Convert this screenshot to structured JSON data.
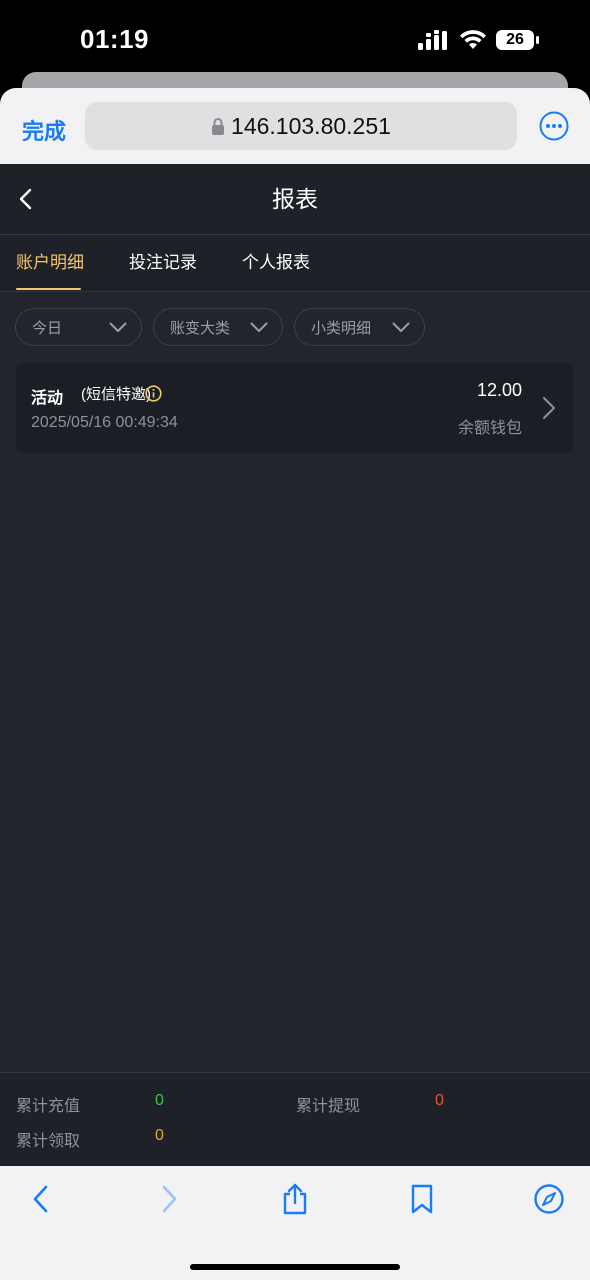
{
  "status_bar": {
    "time": "01:19",
    "battery": "26"
  },
  "browser": {
    "done_label": "完成",
    "url": "146.103.80.251"
  },
  "header": {
    "title": "报表"
  },
  "tabs": [
    {
      "label": "账户明细",
      "active": true
    },
    {
      "label": "投注记录",
      "active": false
    },
    {
      "label": "个人报表",
      "active": false
    }
  ],
  "filters": [
    {
      "label": "今日"
    },
    {
      "label": "账变大类"
    },
    {
      "label": "小类明细"
    }
  ],
  "records": [
    {
      "title": "活动",
      "subtitle": "(短信特邀)",
      "datetime": "2025/05/16 00:49:34",
      "amount": "12.00",
      "wallet": "余额钱包"
    }
  ],
  "summary": {
    "recharge_label": "累计充值",
    "recharge_value": "0",
    "withdraw_label": "累计提现",
    "withdraw_value": "0",
    "claim_label": "累计领取",
    "claim_value": "0"
  },
  "colors": {
    "accent": "#f3c86b",
    "ios_blue": "#1a7cf5",
    "recharge": "#3cc24a",
    "withdraw": "#e8553f",
    "claim": "#f0a428",
    "background": "#22252e"
  }
}
